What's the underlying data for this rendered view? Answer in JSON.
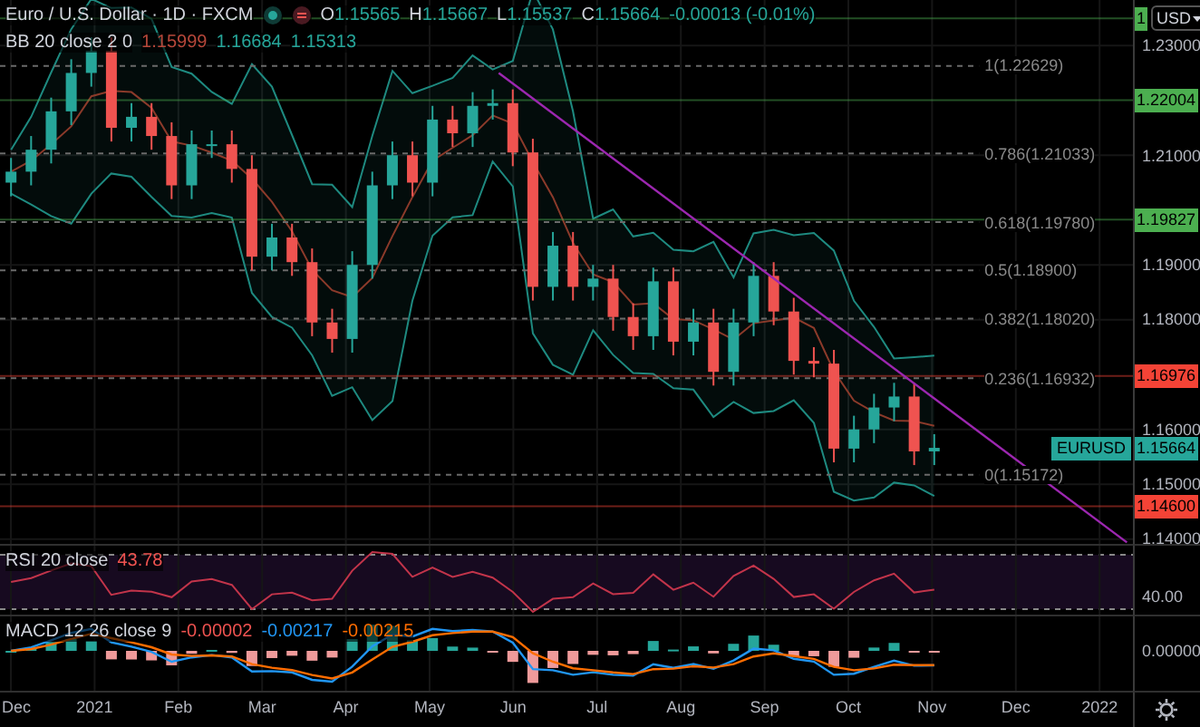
{
  "header": {
    "title": "Euro / U.S. Dollar · 1D · FXCM",
    "ohlc": [
      {
        "key": "O",
        "value": "1.15565"
      },
      {
        "key": "H",
        "value": "1.15667"
      },
      {
        "key": "L",
        "value": "1.15537"
      },
      {
        "key": "C",
        "value": "1.15664"
      }
    ],
    "change": "-0.00013 (-0.01%)"
  },
  "bb_legend": {
    "label": "BB 20 close 2 0",
    "values": [
      {
        "text": "1.15999",
        "color": "#b7473a"
      },
      {
        "text": "1.16684",
        "color": "#26a69a"
      },
      {
        "text": "1.15313",
        "color": "#26a69a"
      }
    ]
  },
  "currency_button": {
    "label": "USD"
  },
  "price_chart": {
    "symbol": "EURUSD",
    "last_price": "1.15664",
    "price_ticks": [
      "1.23000",
      "1.21000",
      "1.19000",
      "1.18000",
      "1.16000",
      "1.15000",
      "1.14000"
    ],
    "levels": [
      {
        "label": "1",
        "color": "#4caf50"
      },
      {
        "label": "1.22004",
        "color": "#4caf50"
      },
      {
        "label": "1.19827",
        "color": "#4caf50"
      },
      {
        "label": "1.16976",
        "color": "#f44336"
      },
      {
        "label": "1.14600",
        "color": "#f44336"
      }
    ],
    "fib_levels": [
      "1(1.22629)",
      "0.786(1.21033)",
      "0.618(1.19780)",
      "0.5(1.18900)",
      "0.382(1.18020)",
      "0.236(1.16932)",
      "0(1.15172)"
    ]
  },
  "rsi": {
    "label": "RSI 20 close",
    "value": "43.78",
    "axis_label": "40.00"
  },
  "macd": {
    "label": "MACD 12 26 close 9",
    "values": [
      {
        "text": "-0.00002",
        "color": "#ef5350"
      },
      {
        "text": "-0.00217",
        "color": "#2196f3"
      },
      {
        "text": "-0.00215",
        "color": "#ff6d00"
      }
    ],
    "axis_label": "0.00000"
  },
  "time_axis": [
    "Dec",
    "2021",
    "Feb",
    "Mar",
    "Apr",
    "May",
    "Jun",
    "Jul",
    "Aug",
    "Sep",
    "Oct",
    "Nov",
    "Dec",
    "2022"
  ]
}
